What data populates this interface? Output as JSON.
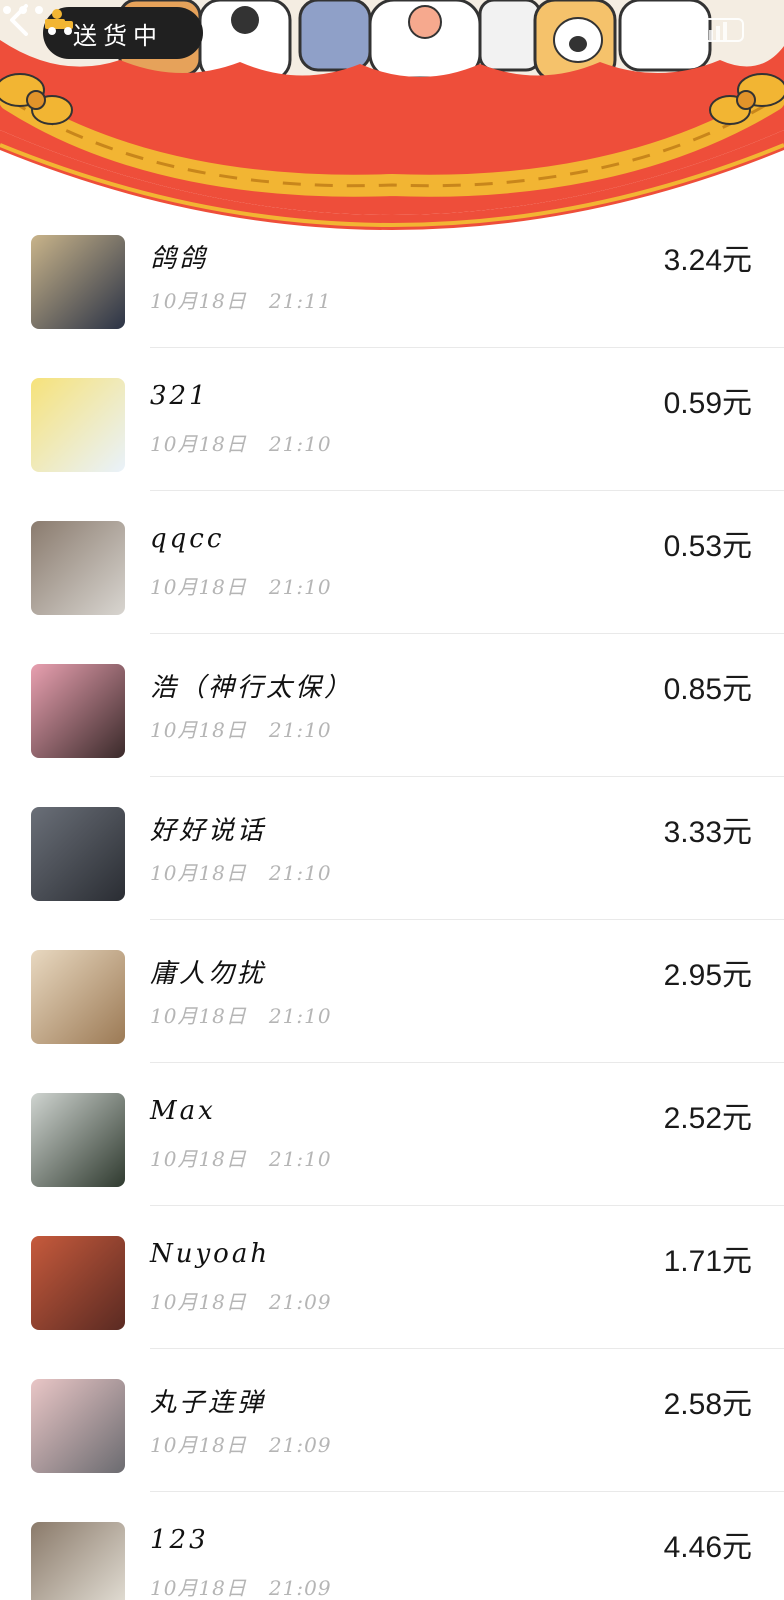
{
  "status_pill": {
    "label": "送货中",
    "icon": "delivery-truck-icon"
  },
  "header": {
    "back_icon": "chevron-left-icon",
    "more_icon": "more-dots-icon",
    "theme_color": "#EE4E3A",
    "rope_color": "#F2B533"
  },
  "records": [
    {
      "name": "鸽鸽",
      "date": "10月18日",
      "time": "21:11",
      "amount": "3.24元",
      "avatar_colors": [
        "#2b3346",
        "#c9b48a"
      ]
    },
    {
      "name": "321",
      "date": "10月18日",
      "time": "21:10",
      "amount": "0.59元",
      "avatar_colors": [
        "#e9f2fb",
        "#f6e27a"
      ]
    },
    {
      "name": "qqcc",
      "date": "10月18日",
      "time": "21:10",
      "amount": "0.53元",
      "avatar_colors": [
        "#d8d5d0",
        "#8a7b6e"
      ]
    },
    {
      "name": "浩（神行太保）",
      "date": "10月18日",
      "time": "21:10",
      "amount": "0.85元",
      "avatar_colors": [
        "#3a2a2a",
        "#e8a0b0"
      ]
    },
    {
      "name": "好好说话",
      "date": "10月18日",
      "time": "21:10",
      "amount": "3.33元",
      "avatar_colors": [
        "#2a2d33",
        "#6a6f78"
      ]
    },
    {
      "name": "庸人勿扰",
      "date": "10月18日",
      "time": "21:10",
      "amount": "2.95元",
      "avatar_colors": [
        "#9c7a55",
        "#e8d8c0"
      ]
    },
    {
      "name": "Max",
      "date": "10月18日",
      "time": "21:10",
      "amount": "2.52元",
      "avatar_colors": [
        "#2f3a2f",
        "#cfd4d0"
      ]
    },
    {
      "name": "Nuyoah",
      "date": "10月18日",
      "time": "21:09",
      "amount": "1.71元",
      "avatar_colors": [
        "#5a2a22",
        "#c65a3c"
      ]
    },
    {
      "name": "丸子连弹",
      "date": "10月18日",
      "time": "21:09",
      "amount": "2.58元",
      "avatar_colors": [
        "#6b6b70",
        "#e9c6c6"
      ]
    },
    {
      "name": "123",
      "date": "10月18日",
      "time": "21:09",
      "amount": "4.46元",
      "avatar_colors": [
        "#e7e3da",
        "#8a7a6a"
      ]
    }
  ]
}
